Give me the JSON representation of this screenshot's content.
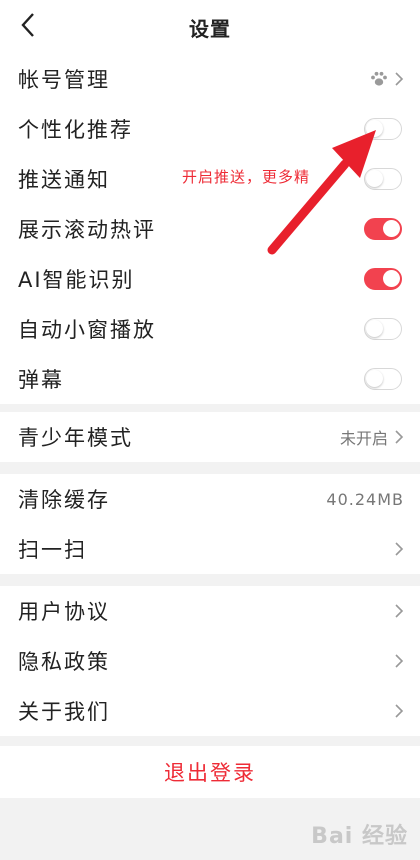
{
  "header": {
    "title": "设置"
  },
  "groups": {
    "g1": {
      "account": {
        "label": "帐号管理",
        "icon": "paw-icon"
      },
      "personalized": {
        "label": "个性化推荐",
        "on": false
      },
      "push": {
        "label": "推送通知",
        "on": false
      },
      "hot_comments": {
        "label": "展示滚动热评",
        "on": true
      },
      "ai": {
        "label": "AI智能识别",
        "on": true
      },
      "mini_window": {
        "label": "自动小窗播放",
        "on": false
      },
      "danmaku": {
        "label": "弹幕",
        "on": false
      }
    },
    "g2": {
      "youth": {
        "label": "青少年模式",
        "value": "未开启"
      }
    },
    "g3": {
      "cache": {
        "label": "清除缓存",
        "value": "40.24MB"
      },
      "scan": {
        "label": "扫一扫"
      }
    },
    "g4": {
      "agreement": {
        "label": "用户协议"
      },
      "privacy": {
        "label": "隐私政策"
      },
      "about": {
        "label": "关于我们"
      }
    }
  },
  "annotation": {
    "text": "开启推送，更多精"
  },
  "logout_label": "退出登录",
  "watermark": "Bai 经验",
  "colors": {
    "accent": "#ee2b36",
    "toggle_on": "#f2424f"
  }
}
